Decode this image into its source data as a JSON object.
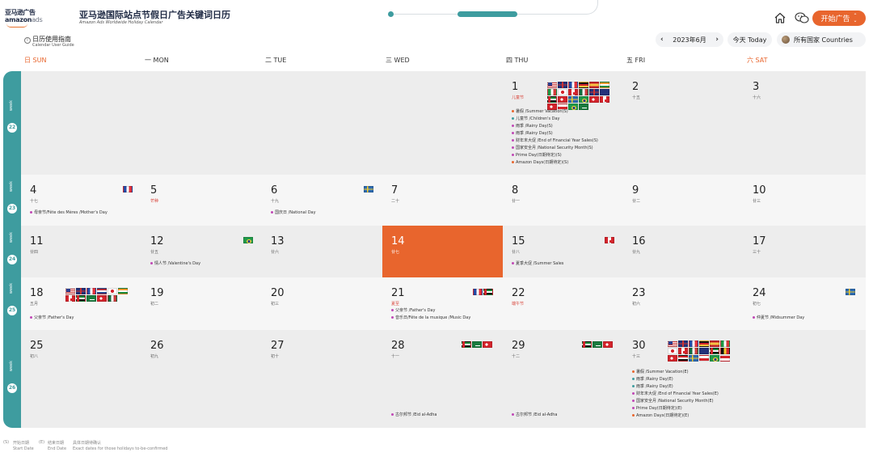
{
  "header": {
    "logo_line1": "亚马逊广告",
    "logo_line2_brand": "amazon",
    "logo_line2_ads": "ads",
    "title_zh": "亚马逊国际站点节假日广告关键词日历",
    "title_en": "Amazon Ads Worldwide Holiday Calendar",
    "start_button": "开始广告",
    "icons": [
      "home-icon",
      "wechat-icon"
    ]
  },
  "guide": {
    "label_zh": "日历使用指南",
    "label_en": "Calendar User Guide"
  },
  "nav": {
    "month_label": "2023年6月",
    "today_label": "今天 Today",
    "country_label": "所有国家 Countries"
  },
  "weekdays": [
    {
      "label": "日 SUN",
      "weekend": true
    },
    {
      "label": "一 MON",
      "weekend": false
    },
    {
      "label": "二 TUE",
      "weekend": false
    },
    {
      "label": "三 WED",
      "weekend": false
    },
    {
      "label": "四 THU",
      "weekend": false
    },
    {
      "label": "五 FRI",
      "weekend": false
    },
    {
      "label": "六 SAT",
      "weekend": true
    }
  ],
  "weeks": [
    {
      "week_label": "week",
      "week_number": "22"
    },
    {
      "week_label": "week",
      "week_number": "23"
    },
    {
      "week_label": "week",
      "week_number": "24"
    },
    {
      "week_label": "week",
      "week_number": "25"
    },
    {
      "week_label": "week",
      "week_number": "26"
    }
  ],
  "days": {
    "d1": {
      "num": "1",
      "lunar": "儿童节",
      "events": [
        "暑假 /Summer Vacation(S)",
        "儿童节 /Children's Day",
        "雨季 /Rainy Day(S)",
        "雨季 /Rainy Day(S)",
        "财年末大促 /End of Financial Year Sales(S)",
        "国家安全月 /National Security Month(S)",
        "Prime Day(日期待定)(S)",
        "Amazon Days(日期待定)(S)"
      ]
    },
    "d2": {
      "num": "2",
      "lunar": "十五"
    },
    "d3": {
      "num": "3",
      "lunar": "十六"
    },
    "d4": {
      "num": "4",
      "lunar": "十七",
      "events": [
        "母亲节/Fête des Mères /Mother's Day"
      ]
    },
    "d5": {
      "num": "5",
      "lunar": "芒种"
    },
    "d6": {
      "num": "6",
      "lunar": "十九",
      "events": [
        "国庆日 /National Day"
      ]
    },
    "d7": {
      "num": "7",
      "lunar": "二十"
    },
    "d8": {
      "num": "8",
      "lunar": "廿一"
    },
    "d9": {
      "num": "9",
      "lunar": "廿二"
    },
    "d10": {
      "num": "10",
      "lunar": "廿三"
    },
    "d11": {
      "num": "11",
      "lunar": "廿四"
    },
    "d12": {
      "num": "12",
      "lunar": "廿五",
      "events": [
        "情人节 /Valentine's Day"
      ]
    },
    "d13": {
      "num": "13",
      "lunar": "廿六"
    },
    "d14": {
      "num": "14",
      "lunar": "廿七"
    },
    "d15": {
      "num": "15",
      "lunar": "廿八",
      "events": [
        "夏季大促 /Summer Sales"
      ]
    },
    "d16": {
      "num": "16",
      "lunar": "廿九"
    },
    "d17": {
      "num": "17",
      "lunar": "三十"
    },
    "d18": {
      "num": "18",
      "lunar": "五月",
      "events": [
        "父亲节 /Father's Day"
      ]
    },
    "d19": {
      "num": "19",
      "lunar": "初二"
    },
    "d20": {
      "num": "20",
      "lunar": "初三"
    },
    "d21": {
      "num": "21",
      "lunar": "夏至",
      "events": [
        "父亲节 /Father's Day",
        "音乐日/Fête de la musique /Music Day"
      ]
    },
    "d22": {
      "num": "22",
      "lunar": "端午节"
    },
    "d23": {
      "num": "23",
      "lunar": "初六"
    },
    "d24": {
      "num": "24",
      "lunar": "初七",
      "events": [
        "仲夏节 /Midsummer Day"
      ]
    },
    "d25": {
      "num": "25",
      "lunar": "初八"
    },
    "d26": {
      "num": "26",
      "lunar": "初九"
    },
    "d27": {
      "num": "27",
      "lunar": "初十"
    },
    "d28": {
      "num": "28",
      "lunar": "十一",
      "events": [
        "古尔邦节 /Eid al-Adha"
      ]
    },
    "d29": {
      "num": "29",
      "lunar": "十二",
      "events": [
        "古尔邦节 /Eid al-Adha"
      ]
    },
    "d30": {
      "num": "30",
      "lunar": "十三",
      "events": [
        "暑假 /Summer Vacation(E)",
        "雨季 /Rainy Day(E)",
        "雨季 /Rainy Day(E)",
        "财年末大促 /End of Financial Year Sales(E)",
        "国家安全月 /National Security Month(E)",
        "Prime Day(日期待定)(E)",
        "Amazon Days(日期待定)(E)"
      ]
    }
  },
  "legend": {
    "s_key": "(S)",
    "s_zh": "开始日期",
    "s_en": "Start Date",
    "e_key": "(E)",
    "e_zh": "结束日期",
    "e_en": "End Date",
    "tbc_zh": "具体日期待确认",
    "tbc_en": "Exact dates for those holidays to-be-confirmed"
  },
  "colors": {
    "accent": "#e8652d",
    "teal": "#3e9c9f"
  }
}
